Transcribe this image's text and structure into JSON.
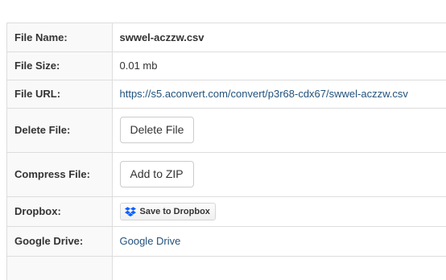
{
  "file_info": {
    "rows": [
      {
        "label": "File Name:",
        "value": "swwel-aczzw.csv"
      },
      {
        "label": "File Size:",
        "value": "0.01 mb"
      },
      {
        "label": "File URL:",
        "value": "https://s5.aconvert.com/convert/p3r68-cdx67/swwel-aczzw.csv"
      },
      {
        "label": "Delete File:",
        "value": "Delete File"
      },
      {
        "label": "Compress File:",
        "value": "Add to ZIP"
      },
      {
        "label": "Dropbox:",
        "value": "Save to Dropbox"
      },
      {
        "label": "Google Drive:",
        "value": "Google Drive"
      }
    ]
  },
  "icons": {
    "dropbox": "dropbox-icon"
  },
  "colors": {
    "link": "#23527c",
    "label_bg": "#f9f9f9",
    "border": "#dddddd",
    "dropbox_blue": "#0061fe"
  }
}
